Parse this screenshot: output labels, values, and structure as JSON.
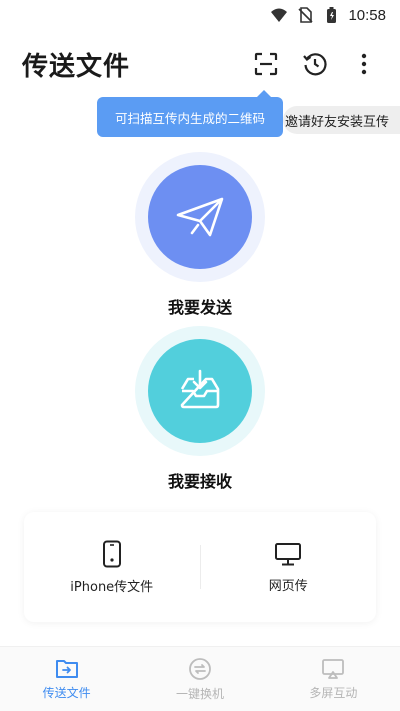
{
  "status_bar": {
    "time": "10:58",
    "icons": [
      "wifi-icon",
      "no-sim-icon",
      "battery-icon"
    ]
  },
  "header": {
    "title": "传送文件",
    "actions": [
      "scan-qr-icon",
      "history-icon",
      "more-vertical-icon"
    ]
  },
  "tooltip": {
    "text": "可扫描互传内生成的二维码"
  },
  "invite_banner": {
    "text": "邀请好友安装互传"
  },
  "actions": {
    "send_label": "我要发送",
    "receive_label": "我要接收"
  },
  "card": {
    "items": [
      {
        "label": "iPhone传文件",
        "icon": "phone-icon"
      },
      {
        "label": "网页传",
        "icon": "monitor-icon"
      }
    ]
  },
  "bottom_nav": {
    "items": [
      {
        "label": "传送文件",
        "icon": "folder-transfer-icon",
        "active": true
      },
      {
        "label": "一键换机",
        "icon": "switch-phone-icon",
        "active": false
      },
      {
        "label": "多屏互动",
        "icon": "cast-screen-icon",
        "active": false
      }
    ]
  },
  "colors": {
    "accent": "#3f8cf0",
    "send_circle": "#6d8ff2",
    "receive_circle": "#52cfdc",
    "tooltip_bg": "#5b9cf3"
  }
}
